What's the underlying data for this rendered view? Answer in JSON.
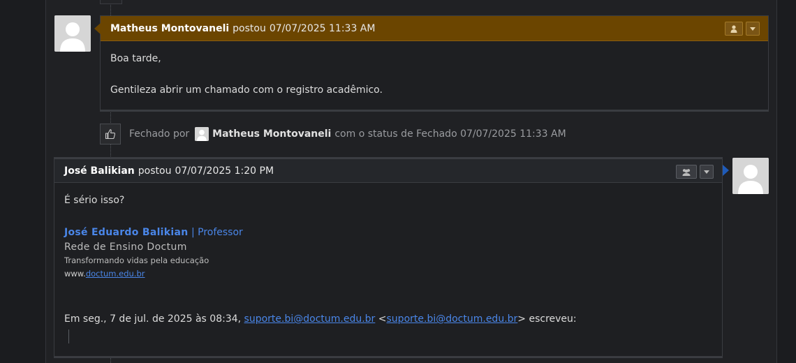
{
  "entries": [
    {
      "author": "Matheus Montovaneli",
      "verb": "postou",
      "timestamp": "07/07/2025 11:33 AM",
      "body": [
        "Boa tarde,",
        "Gentileza abrir um chamado com o registro acadêmico."
      ]
    },
    {
      "author": "José Balikian",
      "verb": "postou",
      "timestamp": "07/07/2025 1:20 PM",
      "body_intro": "É sério isso?",
      "signature": {
        "name": "José Eduardo Balikian",
        "role": "| Professor",
        "org": "Rede de Ensino Doctum",
        "tagline": "Transformando vidas pela educação",
        "site_prefix": "www.",
        "site_link": "doctum.edu.br"
      },
      "reply_line": {
        "prefix": "Em seg., 7 de jul. de 2025 às 08:34,",
        "email1": "suporte.bi@doctum.edu.br",
        "lt": "<",
        "email2": "suporte.bi@doctum.edu.br",
        "suffix": "> escreveu:"
      }
    }
  ],
  "closed_event": {
    "prefix": "Fechado por",
    "user": "Matheus Montovaneli",
    "suffix": "com o status de Fechado 07/07/2025 11:33 AM"
  },
  "colors": {
    "staff_header": "#6b4500",
    "user_caret": "#1f5bb8",
    "link": "#4a86e8"
  },
  "icons": {
    "entry1_button": "user-icon",
    "entry2_button": "users-icon",
    "menu": "caret-down-icon",
    "closed": "thumbs-up-icon"
  }
}
